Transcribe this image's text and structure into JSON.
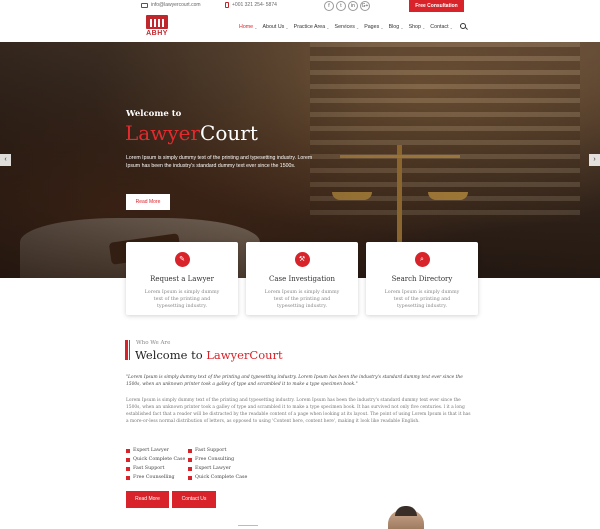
{
  "topbar": {
    "email": "info@lawyercourt.com",
    "phone": "+001 321 254- 5874",
    "social": [
      "f",
      "t",
      "in",
      "G+"
    ],
    "cta": "Free Consultation"
  },
  "logo": {
    "text": "ABHY"
  },
  "nav": {
    "items": [
      {
        "label": "Home",
        "active": true
      },
      {
        "label": "About Us"
      },
      {
        "label": "Practice Area"
      },
      {
        "label": "Services"
      },
      {
        "label": "Pages"
      },
      {
        "label": "Blog"
      },
      {
        "label": "Shop"
      },
      {
        "label": "Contact"
      }
    ]
  },
  "hero": {
    "welcome": "Welcome to",
    "title_red": "Lawyer",
    "title_white": "Court",
    "description": "Lorem Ipsum is simply dummy text of the printing and typesetting industry. Lorem Ipsum has been the industry's standard dummy text ever since the 1500s.",
    "button": "Read More",
    "prev_icon": "‹",
    "next_icon": "›"
  },
  "cards": [
    {
      "icon": "✎",
      "title": "Request a Lawyer",
      "text": "Lorem Ipsum is simply dummy text of the printing and typesetting industry."
    },
    {
      "icon": "⚒",
      "title": "Case Investigation",
      "text": "Lorem Ipsum is simply dummy text of the printing and typesetting industry."
    },
    {
      "icon": "⌕",
      "title": "Search Directory",
      "text": "Lorem Ipsum is simply dummy text of the printing and typesetting industry."
    }
  ],
  "about": {
    "subtitle": "Who We Are",
    "title_black": "Welcome to ",
    "title_red": "LawyerCourt",
    "quote": "\"Lorem Ipsum is simply dummy text of the printing and typesetting industry. Lorem Ipsum has been the industry's standard dummy text ever since the 1500s, when an unknown printer took a galley of type and scrambled it to make a type specimen book.\"",
    "paragraph": "Lorem Ipsum is simply dummy text of the printing and typesetting industry. Lorem Ipsum has been the industry's standard dummy text ever since the 1500s, when an unknown printer took a galley of type and scrambled it to make a type specimen book. It has survived not only five centuries. l it a long established fact that a reader will be distracted by the readable content of a page when looking at its layout. The point of using Lorem Ipsum is that it has a more-or-less normal distribution of letters, as opposed to using 'Content here, content here', making it look like readable English.",
    "list_left": [
      "Expert Lawyer",
      "Quick Complete Case",
      "Fast Support",
      "Free Counselling"
    ],
    "list_right": [
      "Fast Support",
      "Free Consulting",
      "Expert Lawyer",
      "Quick Complete Case"
    ],
    "btn_read": "Read More",
    "btn_contact": "Contact Us"
  }
}
